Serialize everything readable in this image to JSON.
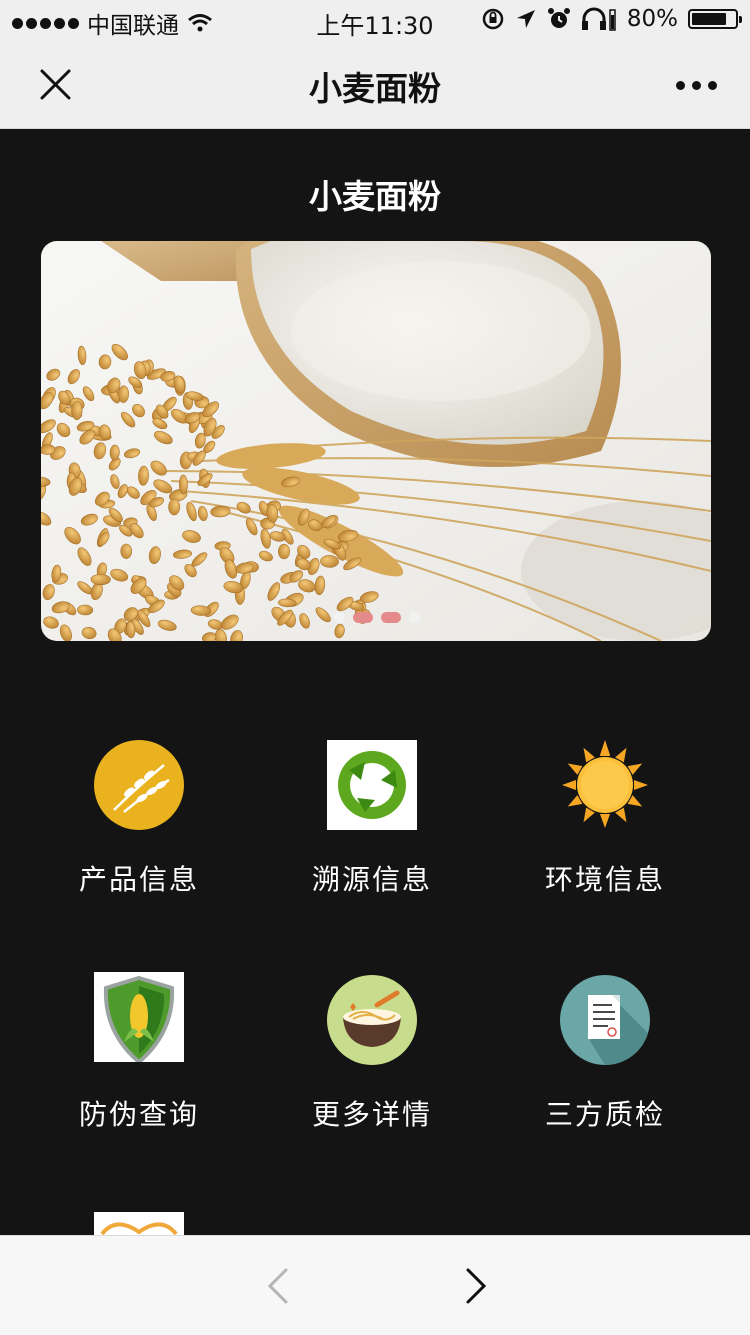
{
  "status_bar": {
    "carrier": "中国联通",
    "time": "上午11:30",
    "battery": "80%",
    "battery_level": 0.8,
    "icons": [
      "wifi-icon",
      "orientation-lock-icon",
      "location-arrow-icon",
      "alarm-icon",
      "headphones-icon",
      "battery-icon"
    ]
  },
  "nav_bar": {
    "title": "小麦面粉",
    "close_icon": "close-icon",
    "more_icon": "more-dots-icon"
  },
  "page": {
    "title": "小麦面粉",
    "banner": {
      "image": "wheat-flour-photo",
      "slide_count": 4,
      "active_slides": [
        1,
        2
      ]
    }
  },
  "menu": {
    "items": [
      {
        "label": "产品信息",
        "icon": "wheat-icon"
      },
      {
        "label": "溯源信息",
        "icon": "recycle-arrows-icon"
      },
      {
        "label": "环境信息",
        "icon": "sun-icon"
      },
      {
        "label": "防伪查询",
        "icon": "shield-corn-icon"
      },
      {
        "label": "更多详情",
        "icon": "noodle-bowl-icon"
      },
      {
        "label": "三方质检",
        "icon": "document-report-icon"
      },
      {
        "label": "",
        "icon": "partial-orange-icon"
      }
    ]
  },
  "toolbar": {
    "back_icon": "chevron-left-icon",
    "forward_icon": "chevron-right-icon"
  },
  "colors": {
    "background": "#141414",
    "nav_background": "#efefef",
    "text_light": "#ffffff",
    "active_dot": "#e48a8a"
  }
}
